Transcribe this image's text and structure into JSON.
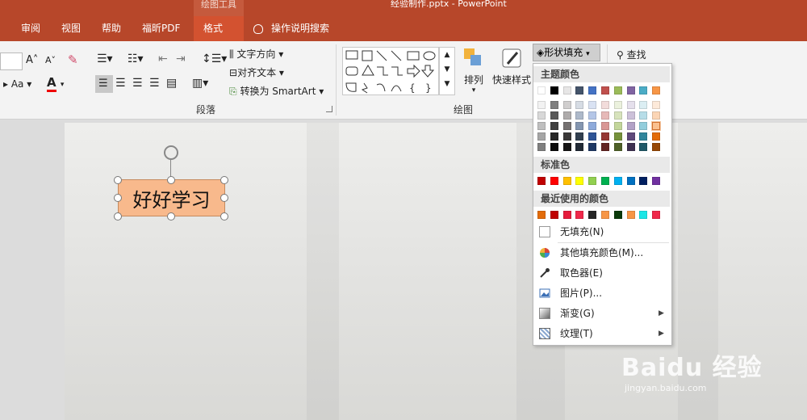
{
  "titlebar": {
    "context_group": "绘图工具",
    "doc_title": "经验制作.pptx  -  PowerPoint"
  },
  "tabs": [
    {
      "label": "审阅"
    },
    {
      "label": "视图"
    },
    {
      "label": "帮助"
    },
    {
      "label": "福昕PDF"
    },
    {
      "label": "格式"
    }
  ],
  "tell_me": "操作说明搜索",
  "ribbon": {
    "paragraph_label": "段落",
    "drawing_label": "绘图",
    "text_direction": "文字方向",
    "align_text": "对齐文本",
    "convert_smartart": "转换为 SmartArt",
    "arrange": "排列",
    "quick_styles": "快速样式",
    "shape_fill": "形状填充",
    "find": "查找",
    "font_aa": "Aa"
  },
  "slide": {
    "textbox_text": "好好学习"
  },
  "menu": {
    "theme_colors_label": "主题颜色",
    "standard_colors_label": "标准色",
    "recent_colors_label": "最近使用的颜色",
    "no_fill": "无填充(N)",
    "more_fill": "其他填充颜色(M)...",
    "eyedropper": "取色器(E)",
    "picture": "图片(P)...",
    "gradient": "渐变(G)",
    "texture": "纹理(T)",
    "theme_top_row": [
      "#ffffff",
      "#000000",
      "#e7e6e6",
      "#44546a",
      "#4472c4",
      "#c0504d",
      "#9bbb59",
      "#8064a2",
      "#4bacc6",
      "#f79646"
    ],
    "theme_shades": [
      [
        "#f2f2f2",
        "#d8d8d8",
        "#bfbfbf",
        "#a5a5a5",
        "#7f7f7f"
      ],
      [
        "#7f7f7f",
        "#595959",
        "#3f3f3f",
        "#262626",
        "#0c0c0c"
      ],
      [
        "#d0cece",
        "#aeabab",
        "#757171",
        "#3a3838",
        "#171616"
      ],
      [
        "#d6dce4",
        "#adb9ca",
        "#8496b0",
        "#323f4f",
        "#222a35"
      ],
      [
        "#d9e2f3",
        "#b4c6e7",
        "#8eaadb",
        "#2f5496",
        "#1f3864"
      ],
      [
        "#f2dcdb",
        "#e6b9b8",
        "#d99694",
        "#953734",
        "#632523"
      ],
      [
        "#ebf1dd",
        "#d7e3bc",
        "#c3d69b",
        "#76923c",
        "#4f6128"
      ],
      [
        "#e5e0ec",
        "#ccc1d9",
        "#b2a2c7",
        "#5f497a",
        "#3f3151"
      ],
      [
        "#dbeef3",
        "#b7dde8",
        "#92cddc",
        "#31859b",
        "#205867"
      ],
      [
        "#fdeada",
        "#fbd5b5",
        "#fac08f",
        "#e36c09",
        "#974806"
      ]
    ],
    "standard": [
      "#c00000",
      "#ff0000",
      "#ffc000",
      "#ffff00",
      "#92d050",
      "#00b050",
      "#00b0f0",
      "#0070c0",
      "#002060",
      "#7030a0"
    ],
    "recent": [
      "#e36c09",
      "#c00000",
      "#e61c3c",
      "#f0284a",
      "#262626",
      "#f79646",
      "#0a3a0a",
      "#f79646",
      "#1ce6e6",
      "#f0284a"
    ]
  },
  "watermark": {
    "brand": "Baidu 经验",
    "url": "jingyan.baidu.com"
  }
}
